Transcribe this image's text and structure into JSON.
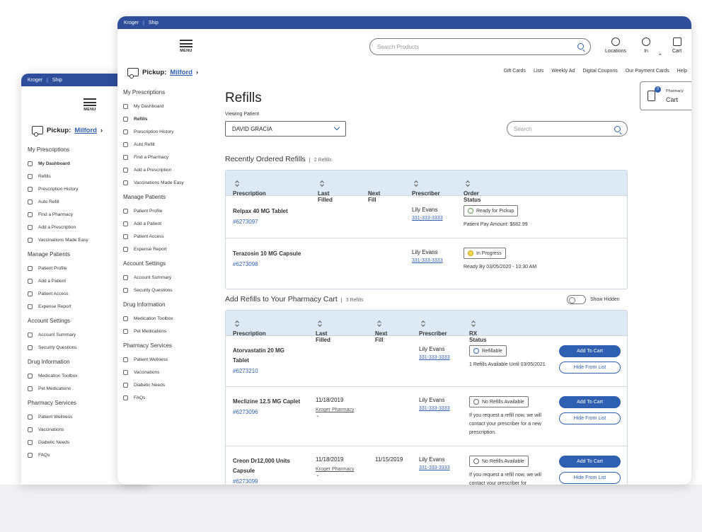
{
  "brand": {
    "kroger": "Kroger",
    "sep": "|",
    "ship": "Ship"
  },
  "menu_label": "MENU",
  "pickup": {
    "label": "Pickup:",
    "store": "Milford"
  },
  "search_placeholder": "Search Products",
  "header_icons": {
    "locations": "Locations",
    "account": "In",
    "cart": "Cart"
  },
  "toplinks": [
    "Gift Cards",
    "Lists",
    "Weekly Ad",
    "Digital Coupons",
    "Our Payment Cards",
    "Help"
  ],
  "pharmacy_cart": {
    "label": "Pharmacy",
    "cart": "Cart",
    "count": "0"
  },
  "sidebar": [
    {
      "section": "My Prescriptions",
      "items": [
        "My Dashboard",
        "Refills",
        "Prescription History",
        "Auto Refill",
        "Find a Pharmacy",
        "Add a Prescription",
        "Vaccinations Made Easy"
      ]
    },
    {
      "section": "Manage Patients",
      "items": [
        "Patient Profile",
        "Add a Patient",
        "Patient Access",
        "Expense Report"
      ]
    },
    {
      "section": "Account Settings",
      "items": [
        "Account Summary",
        "Security Questions"
      ]
    },
    {
      "section": "Drug Information",
      "items": [
        "Medication Toolbox",
        "Pet Medications"
      ]
    },
    {
      "section": "Pharmacy Services",
      "items": [
        "Patient Wellness",
        "Vaccinations",
        "Diabetic Needs",
        "FAQs"
      ]
    }
  ],
  "main": {
    "title": "Refills",
    "viewing_patient": "Viewing Patient",
    "patient": "DAVID GRACIA",
    "search_placeholder": "Search"
  },
  "recent": {
    "title": "Recently Ordered Refills",
    "count": "2 Refills",
    "headers": [
      "Prescription",
      "Last Filled",
      "Next Fill",
      "Prescriber",
      "Order Status"
    ],
    "rows": [
      {
        "drug": "Relpax 40 MG Tablet",
        "rx": "#6273097",
        "prescriber": "Lily Evans",
        "phone": "331-333-3333",
        "status": "Ready for Pickup",
        "note": "Patient Pay Amount: $682.99"
      },
      {
        "drug": "Terazosin 10 MG Capsule",
        "rx": "#6273098",
        "prescriber": "Lily Evans",
        "phone": "331-333-3333",
        "status": "In Progress",
        "note": "Ready By 03/05/2020 - 10:30 AM"
      }
    ]
  },
  "add": {
    "title": "Add Refills to Your Pharmacy Cart",
    "count": "3 Refills",
    "show_hidden": "Show Hidden",
    "headers": [
      "Prescription",
      "Last Filled",
      "Next Fill",
      "Prescriber",
      "RX Status"
    ],
    "add_label": "Add To Cart",
    "hide_label": "Hide From List",
    "rows": [
      {
        "drug": "Atorvastatin 20 MG Tablet",
        "rx": "#6273210",
        "last": "",
        "store": "",
        "next": "",
        "prescriber": "Lily Evans",
        "phone": "331-333-3333",
        "status": "Refillable",
        "note": "1 Refills Available Until 03/05/2021"
      },
      {
        "drug": "Meclizine 12.5 MG Caplet",
        "rx": "#6273096",
        "last": "11/18/2019",
        "store": "Kroger Pharmacy",
        "next": "",
        "prescriber": "Lily Evans",
        "phone": "331-333-3333",
        "status": "No Refills Available",
        "note": "If you request a refill now, we will contact your prescriber for a new prescription."
      },
      {
        "drug": "Creon Dr12,000 Units Capsule",
        "rx": "#6273099",
        "last": "11/18/2019",
        "store": "Kroger Pharmacy",
        "next": "11/15/2019",
        "prescriber": "Lily Evans",
        "phone": "331-333-3333",
        "status": "No Refills Available",
        "note": "If you request a refill now, we will contact your prescriber for"
      }
    ]
  }
}
